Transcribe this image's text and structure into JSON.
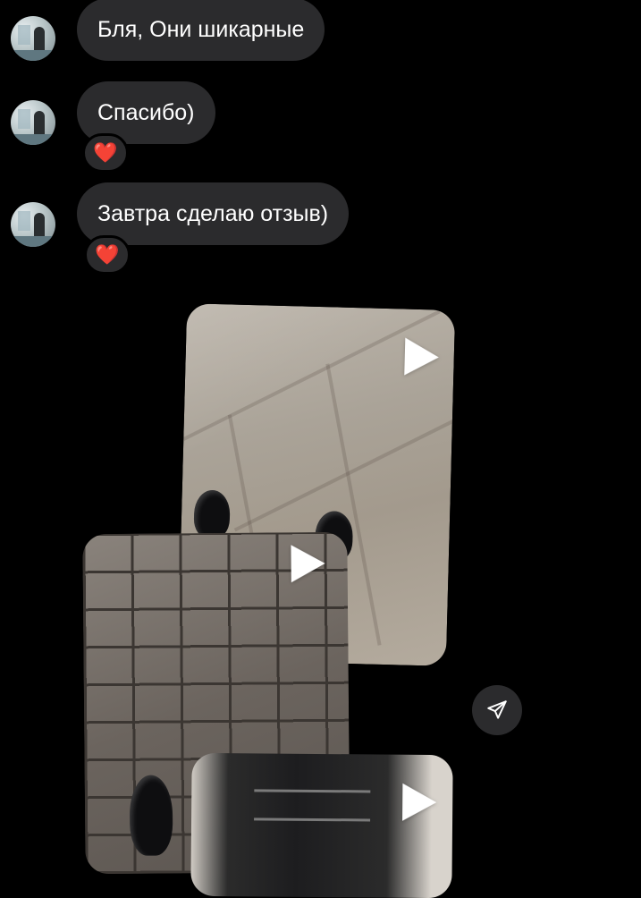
{
  "messages": [
    {
      "text": "Бля, Они шикарные",
      "reaction": ""
    },
    {
      "text": "Спасибо)",
      "reaction": "❤️"
    },
    {
      "text": "Завтра сделаю отзыв)",
      "reaction": "❤️"
    }
  ],
  "media": [
    {
      "type": "video",
      "icon": "play-icon"
    },
    {
      "type": "video",
      "icon": "play-icon"
    },
    {
      "type": "video",
      "icon": "play-icon"
    }
  ],
  "share": {
    "icon": "paper-plane-icon"
  }
}
